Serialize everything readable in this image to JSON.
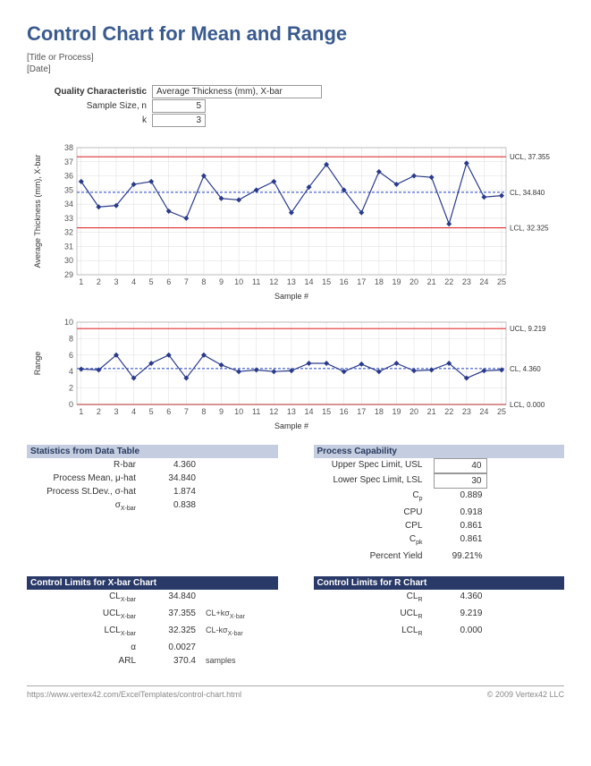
{
  "title": "Control Chart for Mean and Range",
  "subtitle1": "[Title or Process]",
  "subtitle2": "[Date]",
  "qc": {
    "charLabel": "Quality Characteristic",
    "charValue": "Average Thickness (mm), X-bar",
    "sizeLabel": "Sample Size, n",
    "sizeValue": "5",
    "kLabel": "k",
    "kValue": "3"
  },
  "chart_data": [
    {
      "type": "line",
      "title": "",
      "ylabel": "Average Thickness (mm), X-bar",
      "xlabel": "Sample #",
      "x": [
        1,
        2,
        3,
        4,
        5,
        6,
        7,
        8,
        9,
        10,
        11,
        12,
        13,
        14,
        15,
        16,
        17,
        18,
        19,
        20,
        21,
        22,
        23,
        24,
        25
      ],
      "values": [
        35.6,
        33.8,
        33.9,
        35.4,
        35.6,
        33.5,
        33.0,
        36.0,
        34.4,
        34.3,
        35.0,
        35.6,
        33.4,
        35.2,
        36.8,
        35.0,
        33.4,
        36.3,
        35.4,
        36.0,
        35.9,
        32.6,
        36.9,
        34.5,
        34.6
      ],
      "ylim": [
        29,
        38
      ],
      "ticks": [
        29,
        30,
        31,
        32,
        33,
        34,
        35,
        36,
        37,
        38
      ],
      "ucl": {
        "value": 37.355,
        "label": "UCL, 37.355"
      },
      "cl": {
        "value": 34.84,
        "label": "CL, 34.840"
      },
      "lcl": {
        "value": 32.325,
        "label": "LCL, 32.325"
      }
    },
    {
      "type": "line",
      "title": "",
      "ylabel": "Range",
      "xlabel": "Sample #",
      "x": [
        1,
        2,
        3,
        4,
        5,
        6,
        7,
        8,
        9,
        10,
        11,
        12,
        13,
        14,
        15,
        16,
        17,
        18,
        19,
        20,
        21,
        22,
        23,
        24,
        25
      ],
      "values": [
        4.3,
        4.2,
        6.0,
        3.2,
        5.0,
        6.0,
        3.2,
        6.0,
        4.8,
        4.0,
        4.2,
        4.0,
        4.1,
        5.0,
        5.0,
        4.0,
        4.9,
        4.0,
        5.0,
        4.1,
        4.2,
        5.0,
        3.2,
        4.1,
        4.2
      ],
      "ylim": [
        0,
        10
      ],
      "ticks": [
        0,
        2,
        4,
        6,
        8,
        10
      ],
      "ucl": {
        "value": 9.219,
        "label": "UCL, 9.219"
      },
      "cl": {
        "value": 4.36,
        "label": "CL, 4.360"
      },
      "lcl": {
        "value": 0.0,
        "label": "LCL, 0.000"
      }
    }
  ],
  "stats": {
    "header": "Statistics from Data Table",
    "rows": [
      {
        "label": "R-bar",
        "value": "4.360"
      },
      {
        "label": "Process Mean, μ-hat",
        "value": "34.840"
      },
      {
        "label": "Process St.Dev., σ-hat",
        "value": "1.874"
      },
      {
        "label": "σ<sub>X-bar</sub>",
        "value": "0.838"
      }
    ]
  },
  "capability": {
    "header": "Process Capability",
    "rows": [
      {
        "label": "Upper Spec Limit, USL",
        "value": "40",
        "boxed": true
      },
      {
        "label": "Lower Spec Limit, LSL",
        "value": "30",
        "boxed": true
      },
      {
        "label": "C<sub>p</sub>",
        "value": "0.889"
      },
      {
        "label": "CPU",
        "value": "0.918"
      },
      {
        "label": "CPL",
        "value": "0.861"
      },
      {
        "label": "C<sub>pk</sub>",
        "value": "0.861"
      },
      {
        "label": "Percent Yield",
        "value": "99.21%"
      }
    ]
  },
  "limitsX": {
    "header": "Control Limits for X-bar Chart",
    "rows": [
      {
        "label": "CL<sub>X-bar</sub>",
        "value": "34.840",
        "extra": ""
      },
      {
        "label": "UCL<sub>X-bar</sub>",
        "value": "37.355",
        "extra": "CL+kσ<sub>X-bar</sub>"
      },
      {
        "label": "LCL<sub>X-bar</sub>",
        "value": "32.325",
        "extra": "CL-kσ<sub>X-bar</sub>"
      },
      {
        "label": "α",
        "value": "0.0027",
        "extra": ""
      },
      {
        "label": "ARL",
        "value": "370.4",
        "extra": "samples"
      }
    ]
  },
  "limitsR": {
    "header": "Control Limits for R Chart",
    "rows": [
      {
        "label": "CL<sub>R</sub>",
        "value": "4.360"
      },
      {
        "label": "UCL<sub>R</sub>",
        "value": "9.219"
      },
      {
        "label": "LCL<sub>R</sub>",
        "value": "0.000"
      }
    ]
  },
  "footer": {
    "left": "https://www.vertex42.com/ExcelTemplates/control-chart.html",
    "right": "© 2009 Vertex42 LLC"
  }
}
